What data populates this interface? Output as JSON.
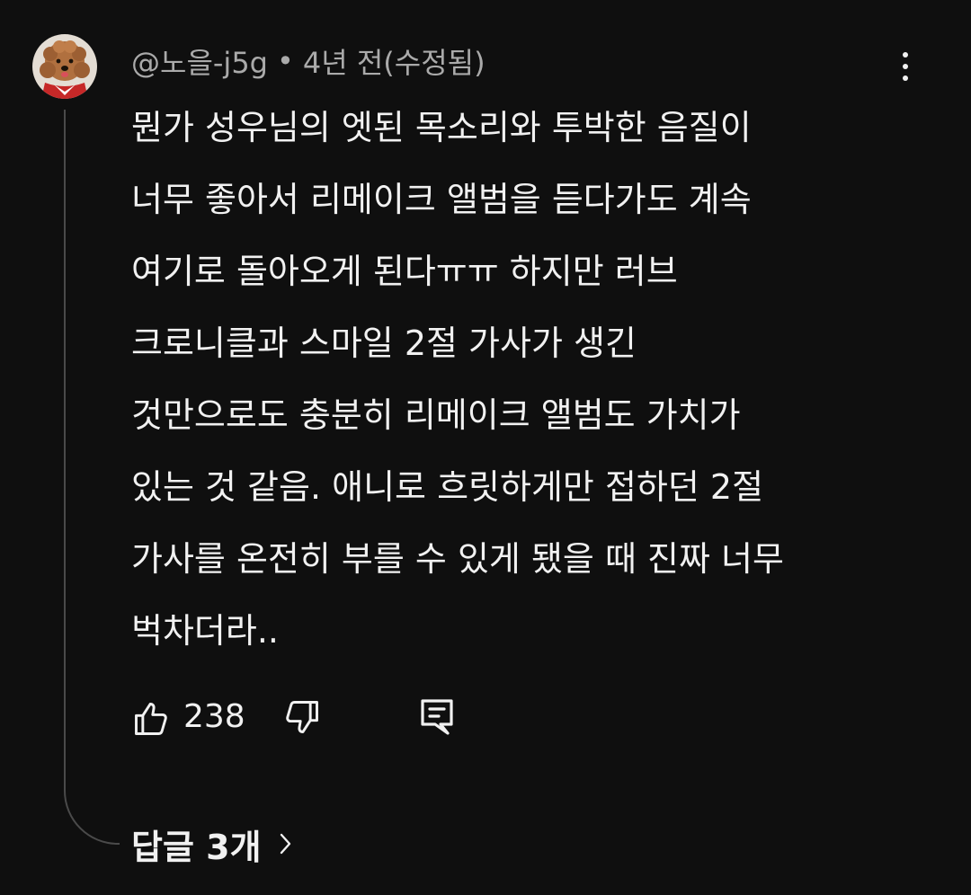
{
  "comment": {
    "author": "@노을-j5g",
    "separator": "•",
    "time": "4년 전(수정됨)",
    "text_lines": [
      "뭔가 성우님의 엣된 목소리와 투박한 음질이",
      "너무 좋아서 리메이크 앨범을 듣다가도 계속",
      "여기로 돌아오게 된다ㅠㅠ 하지만 러브",
      "크로니클과 스마일 2절 가사가 생긴",
      "것만으로도 충분히 리메이크 앨범도 가치가",
      "있는 것 같음. 애니로 흐릿하게만 접하던 2절",
      "가사를 온전히 부를 수 있게 됐을 때 진짜 너무",
      "벅차더라.."
    ],
    "likes": "238",
    "replies_label": "답글 3개"
  },
  "icons": {
    "avatar": "dog-avatar-icon",
    "more": "more-vertical-icon",
    "like": "thumbs-up-icon",
    "dislike": "thumbs-down-icon",
    "reply": "reply-comment-icon",
    "expand": "chevron-right-icon"
  },
  "colors": {
    "background": "#0f0f0f",
    "text_primary": "#f1f1f1",
    "text_secondary": "#aaaaaa",
    "thread_line": "#4a4a4a"
  }
}
